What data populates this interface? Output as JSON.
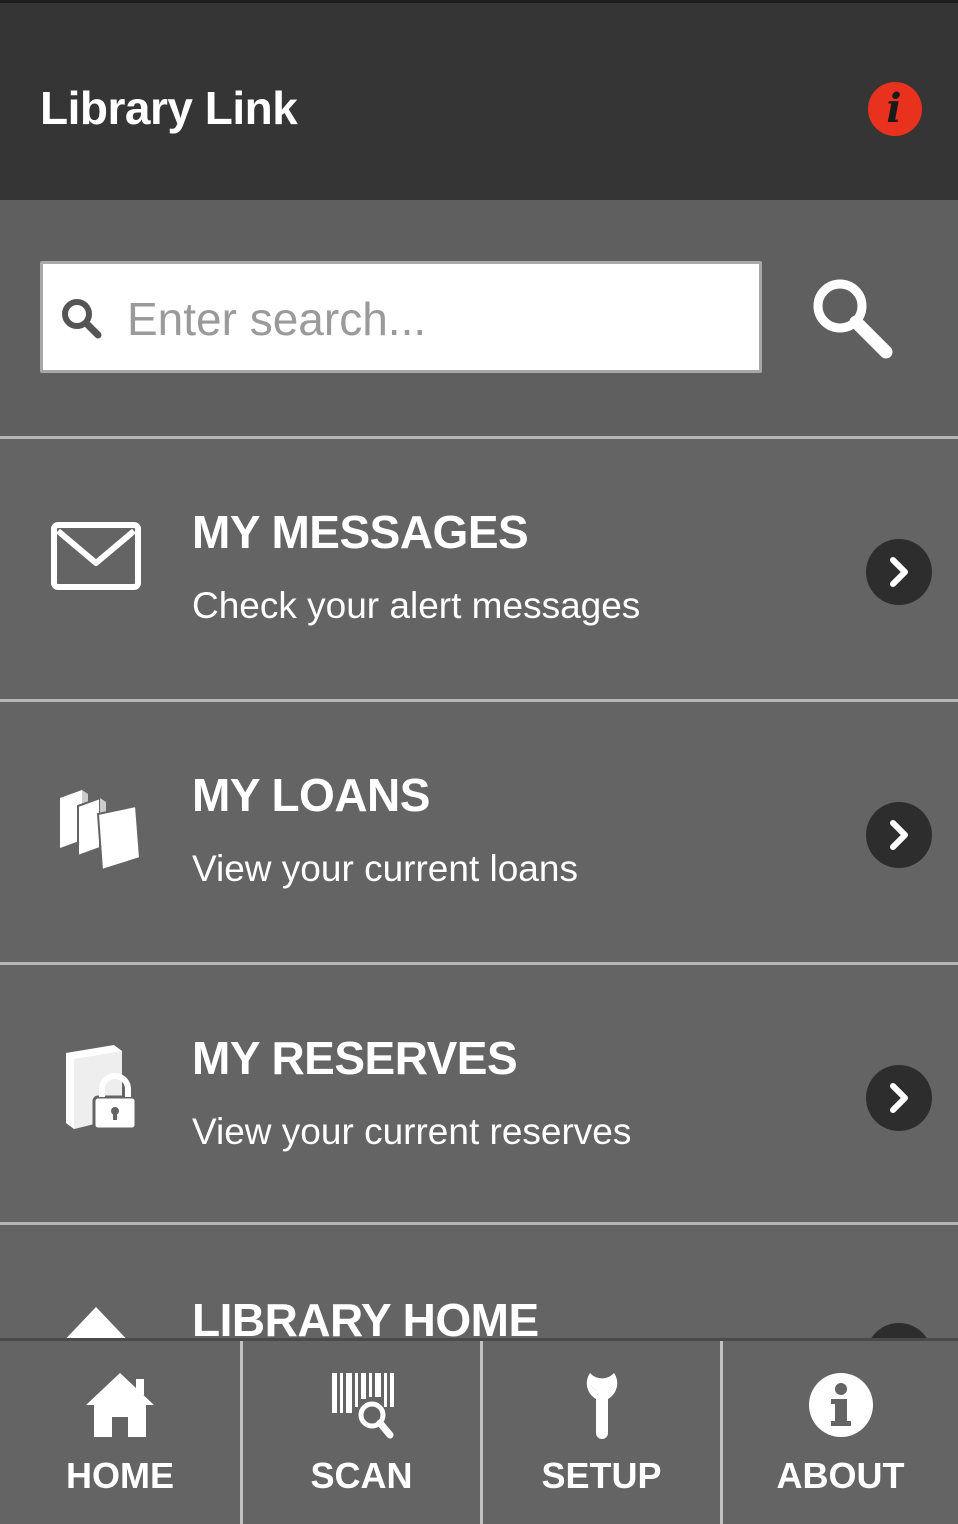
{
  "header": {
    "title": "Library Link",
    "info_icon": "info-icon",
    "accent": "#e8321e"
  },
  "search": {
    "placeholder": "Enter search...",
    "value": ""
  },
  "menu": [
    {
      "title": "MY MESSAGES",
      "subtitle": "Check your alert messages",
      "icon": "envelope-icon"
    },
    {
      "title": "MY LOANS",
      "subtitle": "View your current loans",
      "icon": "books-icon"
    },
    {
      "title": "MY RESERVES",
      "subtitle": "View your current reserves",
      "icon": "book-lock-icon"
    },
    {
      "title": "LIBRARY HOME",
      "subtitle": "",
      "icon": "home-icon"
    }
  ],
  "nav": [
    {
      "label": "HOME",
      "icon": "home-icon"
    },
    {
      "label": "SCAN",
      "icon": "barcode-scan-icon"
    },
    {
      "label": "SETUP",
      "icon": "wrench-icon"
    },
    {
      "label": "ABOUT",
      "icon": "info-icon"
    }
  ]
}
